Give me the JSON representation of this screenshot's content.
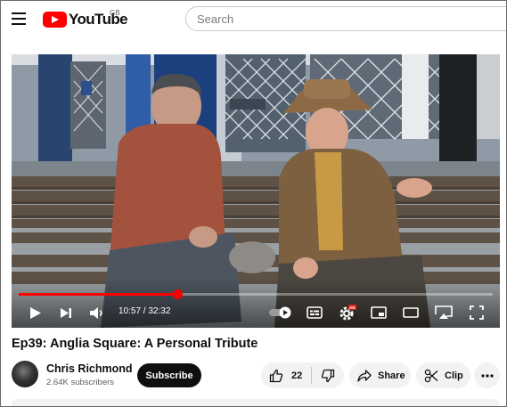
{
  "header": {
    "logo_text": "YouTube",
    "country_code": "GB",
    "search_placeholder": "Search"
  },
  "player": {
    "current_time": "10:57",
    "duration": "32:32",
    "time_display": "10:57 / 32:32",
    "progress_fraction": 0.335,
    "hd_badge": "HD",
    "accent_color": "#ff0000"
  },
  "video": {
    "title": "Ep39: Anglia Square: A Personal Tribute"
  },
  "channel": {
    "name": "Chris Richmond",
    "subscribers": "2.64K subscribers",
    "subscribe_label": "Subscribe"
  },
  "actions": {
    "like_count": "22",
    "share_label": "Share",
    "clip_label": "Clip"
  },
  "icons": [
    "hamburger-menu-icon",
    "youtube-logo-icon",
    "play-icon",
    "next-icon",
    "volume-icon",
    "autoplay-toggle-icon",
    "subtitles-icon",
    "settings-icon",
    "miniplayer-icon",
    "theater-icon",
    "cast-icon",
    "fullscreen-icon",
    "thumbs-up-icon",
    "thumbs-down-icon",
    "share-icon",
    "scissors-icon",
    "more-icon"
  ]
}
